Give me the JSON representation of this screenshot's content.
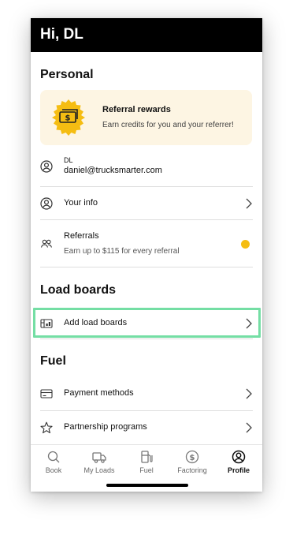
{
  "header": {
    "greeting": "Hi, DL"
  },
  "personal": {
    "title": "Personal",
    "referral_card": {
      "title": "Referral rewards",
      "subtitle": "Earn credits for you and your referrer!",
      "badge_color": "#f5bd12"
    },
    "account": {
      "name": "DL",
      "email": "daniel@trucksmarter.com"
    },
    "your_info_label": "Your info",
    "referrals": {
      "label": "Referrals",
      "subtitle": "Earn up to $115 for every referral",
      "dot_color": "#f5bd12"
    }
  },
  "load_boards": {
    "title": "Load boards",
    "add_label": "Add load boards",
    "highlight_color": "#74dea4"
  },
  "fuel": {
    "title": "Fuel",
    "payment_methods_label": "Payment methods",
    "partnership_programs_label": "Partnership programs"
  },
  "tabs": [
    {
      "label": "Book",
      "icon": "search-icon",
      "active": false
    },
    {
      "label": "My Loads",
      "icon": "truck-icon",
      "active": false
    },
    {
      "label": "Fuel",
      "icon": "fuel-pump-icon",
      "active": false
    },
    {
      "label": "Factoring",
      "icon": "dollar-icon",
      "active": false
    },
    {
      "label": "Profile",
      "icon": "profile-icon",
      "active": true
    }
  ]
}
